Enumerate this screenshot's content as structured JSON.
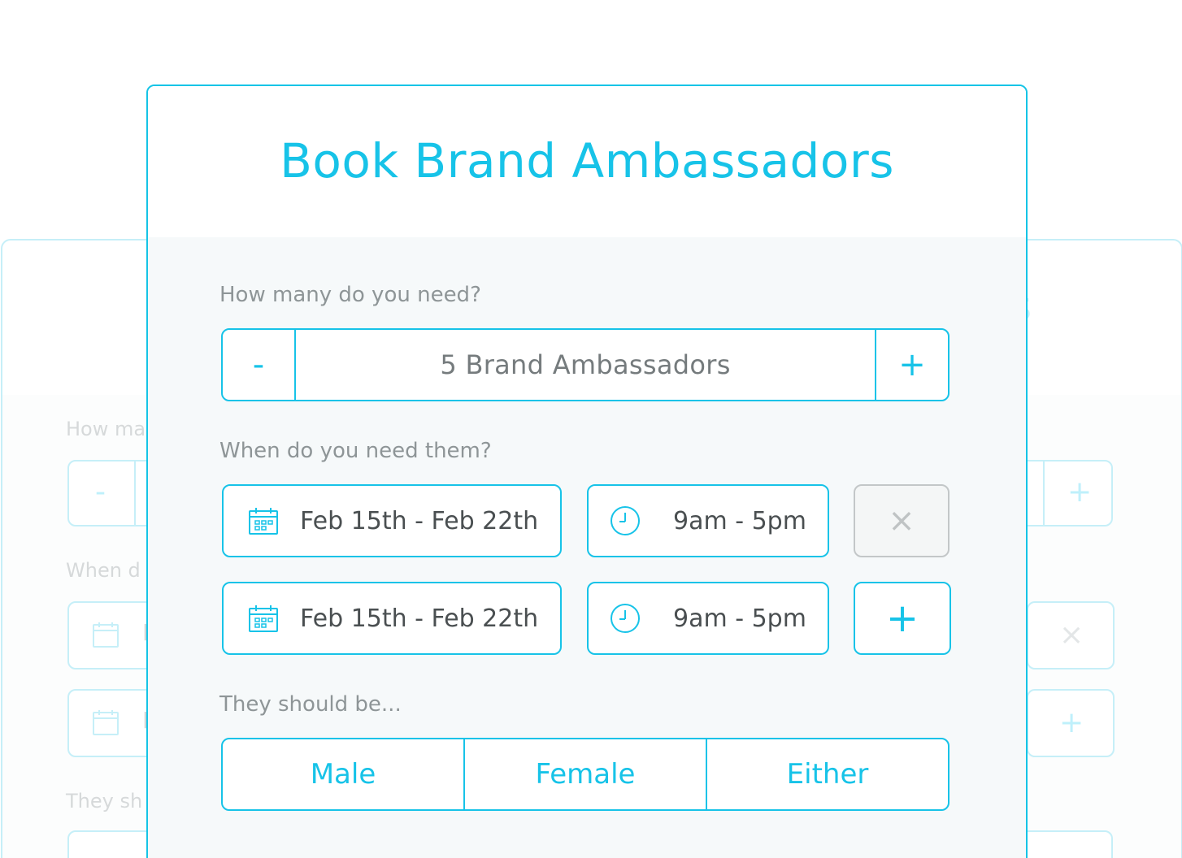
{
  "background_card": {
    "title_fragment": "s",
    "labels": {
      "quantity": "How ma",
      "schedule": "When d",
      "gender": "They sh"
    },
    "date_fragment": "F",
    "minus_glyph": "-",
    "plus_glyph": "+",
    "remove_glyph": "×"
  },
  "form": {
    "title": "Book Brand Ambassadors",
    "quantity": {
      "label": "How many do you need?",
      "decrement_label": "-",
      "increment_label": "+",
      "value": "5 Brand Ambassadors"
    },
    "schedule": {
      "label": "When do you need them?",
      "rows": [
        {
          "date_range": "Feb 15th - Feb 22th",
          "time_range": "9am - 5pm",
          "action": "remove",
          "action_glyph": "×"
        },
        {
          "date_range": "Feb 15th - Feb 22th",
          "time_range": "9am - 5pm",
          "action": "add",
          "action_glyph": "+"
        }
      ]
    },
    "gender": {
      "label": "They should be...",
      "options": [
        "Male",
        "Female",
        "Either"
      ]
    }
  },
  "icons": {
    "date": "calendar-icon",
    "time": "clock-icon"
  },
  "colors": {
    "accent": "#17c3e8",
    "accent_faded": "#c6eff8",
    "label_gray": "#8e9597",
    "text_dark": "#4a4f51",
    "value_gray": "#757b7d",
    "body_bg": "#f6f9fa",
    "disabled_border": "#c3c7c8"
  }
}
